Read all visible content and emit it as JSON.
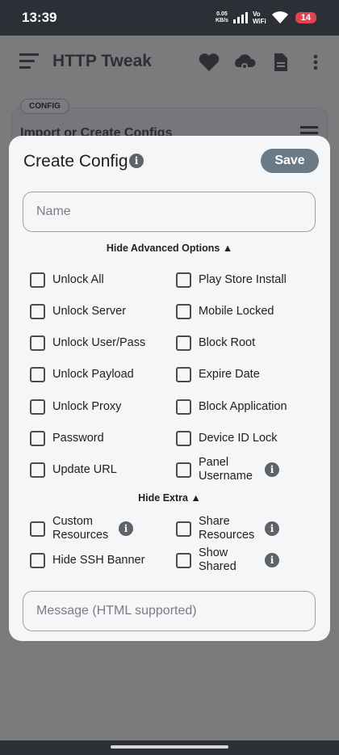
{
  "status": {
    "time": "13:39",
    "net_speed_value": "0.05",
    "net_speed_unit": "KB/s",
    "volte_top": "Vo",
    "volte_bottom": "WiFi",
    "battery": "14"
  },
  "app_bar": {
    "title": "HTTP Tweak",
    "icons": [
      "menu-icon",
      "heart-icon",
      "cloud-sync-icon",
      "document-icon",
      "more-vert-icon"
    ]
  },
  "background": {
    "chip": "CONFIG",
    "card_title": "Import or Create Configs"
  },
  "dialog": {
    "title": "Create Config",
    "save_label": "Save",
    "name_placeholder": "Name",
    "advanced_toggle": "Hide Advanced Options ▲",
    "extra_toggle": "Hide Extra ▲",
    "message_placeholder": "Message (HTML supported)",
    "advanced_options": [
      {
        "left": "Unlock All",
        "right": "Play Store Install"
      },
      {
        "left": "Unlock Server",
        "right": "Mobile Locked"
      },
      {
        "left": "Unlock User/Pass",
        "right": "Block Root"
      },
      {
        "left": "Unlock Payload",
        "right": "Expire Date"
      },
      {
        "left": "Unlock Proxy",
        "right": "Block Application"
      },
      {
        "left": "Password",
        "right": "Device ID Lock"
      },
      {
        "left": "Update URL",
        "right": "Panel Username"
      }
    ],
    "extra_options": [
      {
        "left": "Custom Resources",
        "right": "Share Resources"
      },
      {
        "left": "Hide SSH Banner",
        "right": "Show Shared"
      }
    ],
    "info_glyph": "i"
  }
}
